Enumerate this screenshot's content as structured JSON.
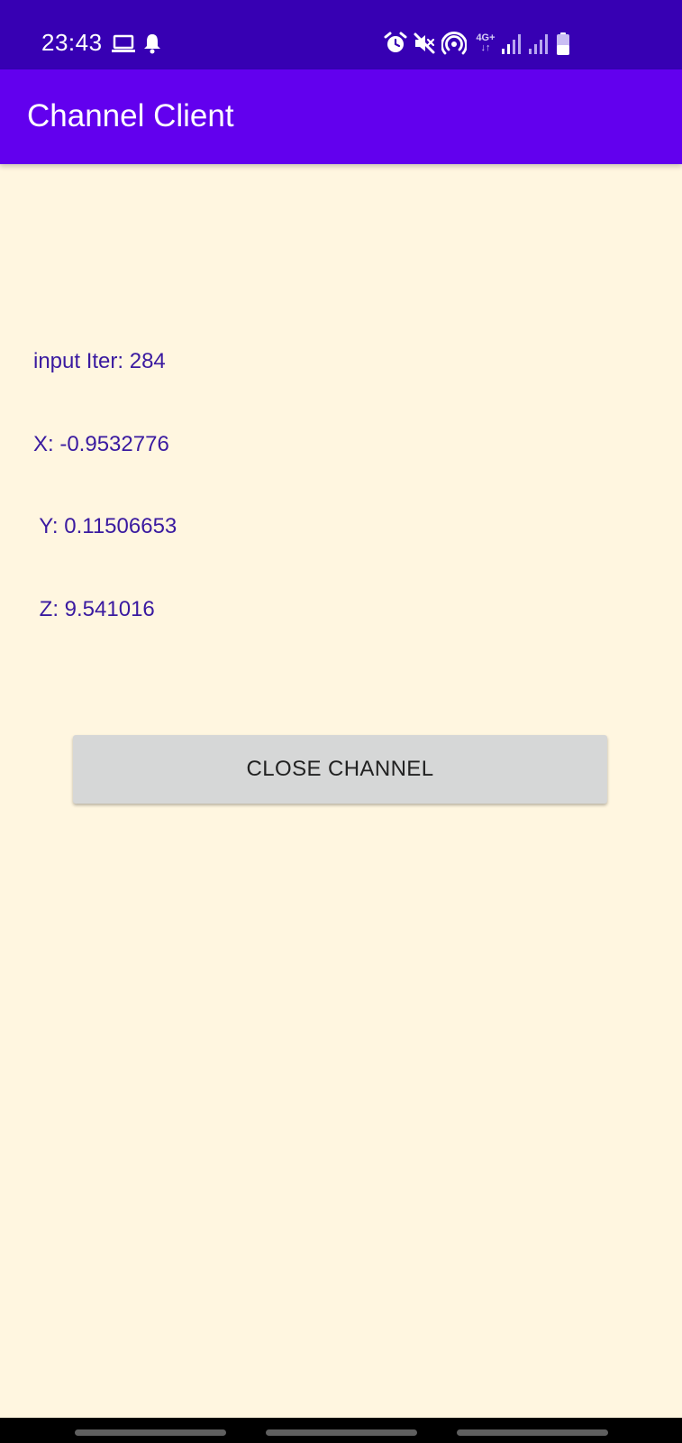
{
  "status_bar": {
    "time": "23:43",
    "network_type": "4G+",
    "left_icons": [
      "laptop-icon",
      "notification-bell-icon"
    ],
    "right_icons": [
      "alarm-icon",
      "mute-icon",
      "hotspot-icon",
      "network-4g-icon",
      "signal-icon",
      "signal-icon",
      "battery-icon"
    ]
  },
  "app_bar": {
    "title": "Channel Client"
  },
  "readout": {
    "iter_line": "input Iter: 284",
    "x_line": "X: -0.9532776",
    "y_line": " Y: 0.11506653",
    "z_line": " Z: 9.541016"
  },
  "actions": {
    "close_channel_label": "CLOSE CHANNEL"
  },
  "colors": {
    "status_bar": "#3700b3",
    "app_bar": "#6200ee",
    "background": "#fff6e0",
    "readout_text": "#3a1aa0",
    "button": "#d6d7d7"
  }
}
